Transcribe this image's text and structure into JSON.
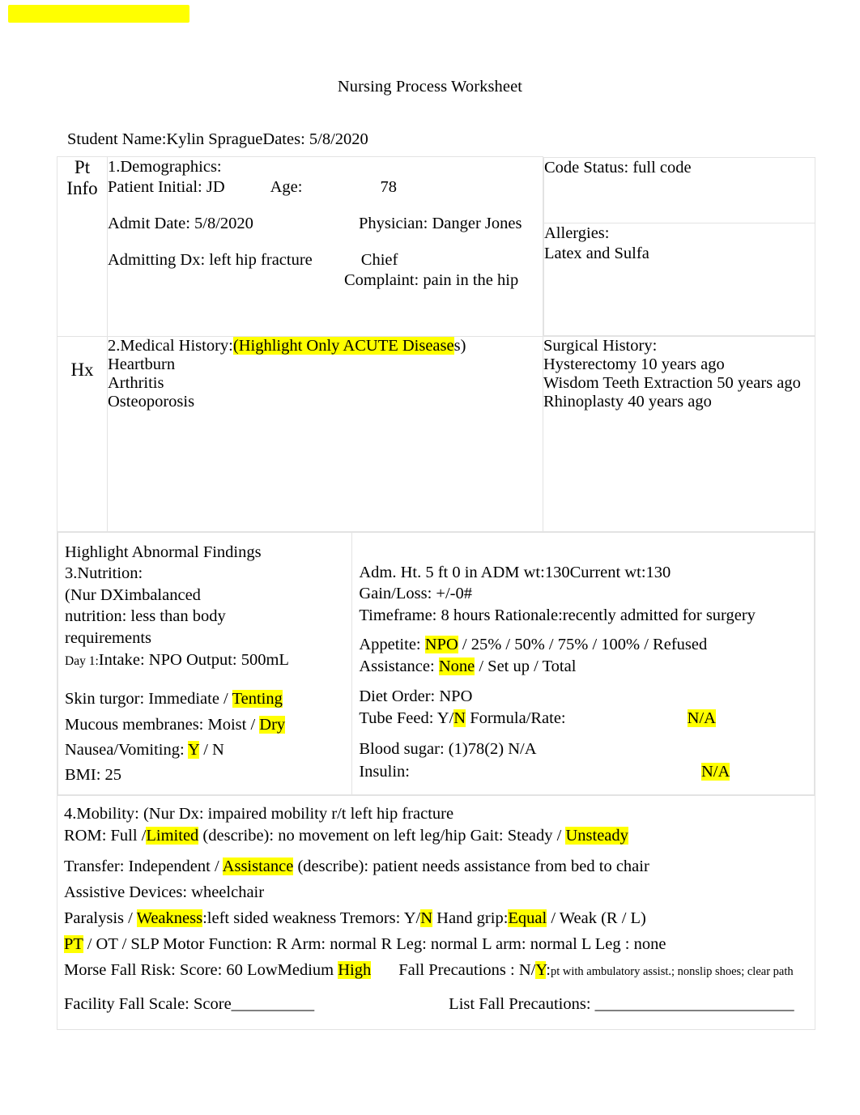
{
  "document": {
    "title": "Nursing Process Worksheet",
    "top_highlight_bar": "",
    "student_line": "Student Name:Kylin SpragueDates: 5/8/2020",
    "accent_highlight_color": "#ffff00",
    "border_color": "#e3e3e3"
  },
  "row_labels": {
    "pt_info_line1": "Pt",
    "pt_info_line2": "Info",
    "hx": "Hx"
  },
  "demographics": {
    "heading": "1.Demographics:",
    "patient_initial_label": "Patient Initial: JD",
    "age_label": "Age:",
    "age_value": "78",
    "admit_date": "Admit Date: 5/8/2020",
    "physician": "Physician: Danger Jones",
    "admitting_dx": "Admitting Dx: left hip fracture",
    "chief": "Chief",
    "complaint": "Complaint: pain in the hip"
  },
  "code_status": {
    "text": "Code Status: full code"
  },
  "allergies": {
    "label": "Allergies:",
    "value": "Latex and Sulfa"
  },
  "medical_history": {
    "heading_plain": "2.Medical History:",
    "heading_highlighted": "(Highlight Only ACUTE Disease",
    "heading_tail": "s)",
    "items": [
      "Heartburn",
      "Arthritis",
      "Osteoporosis"
    ]
  },
  "surgical_history": {
    "label": "Surgical History:",
    "items": [
      "Hysterectomy 10 years ago",
      "Wisdom Teeth Extraction 50 years ago",
      "Rhinoplasty 40 years ago"
    ]
  },
  "nutrition": {
    "highlight_note": "Highlight Abnormal Findings",
    "heading": "3.Nutrition:",
    "nur_dx_line1": "(Nur DXimbalanced",
    "nur_dx_line2": "nutrition: less than body",
    "nur_dx_line3": "requirements",
    "day_label": "Day 1:",
    "intake_output": "Intake: NPO Output: 500mL",
    "skin_turgor_label": "Skin turgor: Immediate / ",
    "skin_turgor_value": "Tenting",
    "mucous_label": "Mucous membranes: Moist / ",
    "mucous_value": "Dry",
    "nausea_label": "Nausea/Vomiting: ",
    "nausea_yes": "Y",
    "nausea_rest": " / N",
    "bmi": "BMI: 25",
    "adm_line": "Adm. Ht. 5 ft 0 in ADM wt:130Current wt:130",
    "gain_loss": "Gain/Loss: +/-0#",
    "timeframe": "Timeframe: 8 hours Rationale:recently admitted for surgery",
    "appetite_label": "Appetite: ",
    "appetite_value": "NPO",
    "appetite_rest": " / 25% / 50% / 75% / 100% / Refused",
    "assistance_label": "Assistance: ",
    "assistance_value": "None",
    "assistance_rest": " / Set up / Total",
    "diet_order": "Diet Order: NPO",
    "tube_feed_label": "Tube Feed: Y/",
    "tube_feed_value": "N",
    "tube_feed_rest": " Formula/Rate:",
    "tube_feed_na": "N/A",
    "blood_sugar": "Blood sugar: (1)78(2) N/A",
    "insulin_label": "Insulin:",
    "insulin_na": "N/A"
  },
  "mobility": {
    "heading": "4.Mobility:  (Nur Dx: impaired mobility r/t left hip fracture",
    "rom_label": "ROM: Full /",
    "rom_value": "Limited",
    "rom_rest": " (describe): no movement on left leg/hip Gait: Steady / ",
    "gait_value": "Unsteady",
    "transfer_label": "Transfer: Independent / ",
    "transfer_value": "Assistance",
    "transfer_rest": " (describe): patient needs assistance from bed to chair",
    "assistive_devices": "Assistive Devices: wheelchair",
    "paralysis_label": " Paralysis / ",
    "weakness_value": "Weakness",
    "weakness_rest": ":left sided weakness  Tremors: Y/",
    "tremors_value": "N",
    "handgrip_label": " Hand grip:",
    "handgrip_value": "Equal",
    "handgrip_rest": " / Weak (R / L)",
    "pt_value": "PT",
    "therapy_rest": " / OT / SLP  Motor Function: R Arm: normal R Leg: normal L arm: normal L Leg : none",
    "morse_label": "Morse Fall Risk: Score: 60 LowMedium ",
    "morse_value": "High",
    "fall_precautions_label": "Fall Precautions : N/",
    "fall_precautions_value": "Y",
    "fall_precautions_colon": ":",
    "fall_precautions_detail": "pt with ambulatory assist.; nonslip shoes; clear path",
    "facility_label": "Facility Fall Scale: Score",
    "facility_blank": "__________",
    "list_precautions_label": "List Fall Precautions:  ",
    "list_precautions_blank": "________________________"
  }
}
